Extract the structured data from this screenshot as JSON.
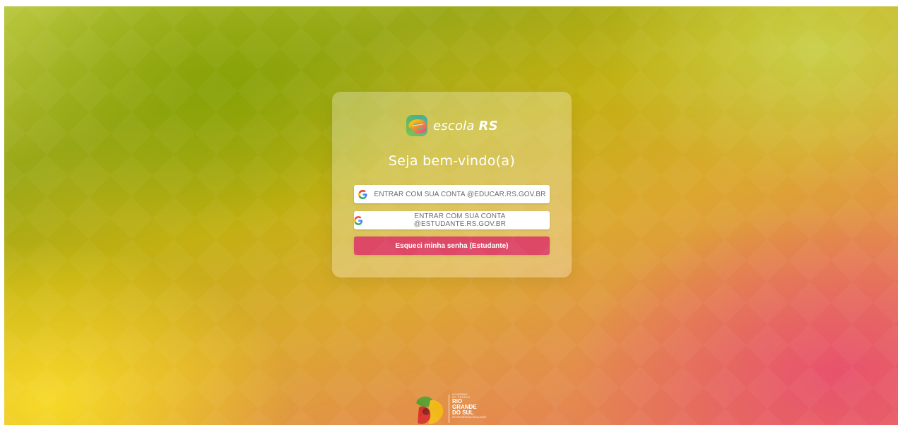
{
  "app": {
    "brand_prefix": "escola",
    "brand_suffix": "RS"
  },
  "login": {
    "title": "Seja bem-vindo(a)",
    "google_educar_label": "ENTRAR COM SUA CONTA @EDUCAR.RS.GOV.BR",
    "google_estudante_label": "ENTRAR COM SUA CONTA @ESTUDANTE.RS.GOV.BR",
    "forgot_password_label": "Esqueci minha senha (Estudante)"
  },
  "footer": {
    "gov_line1": "GOVERNO",
    "gov_line2": "DO ESTADO",
    "gov_name_1": "RIO",
    "gov_name_2": "GRANDE",
    "gov_name_3": "DO SUL",
    "gov_department": "SECRETARIA DA EDUCAÇÃO"
  },
  "icons": {
    "brand_logo": "escola-rs-e-logo-icon",
    "google": "google-g-icon",
    "gov_emblem": "rs-government-emblem-icon"
  },
  "colors": {
    "forgot_button": "#dd4867",
    "google_button": "#ffffff",
    "title_text": "#ffffff"
  }
}
